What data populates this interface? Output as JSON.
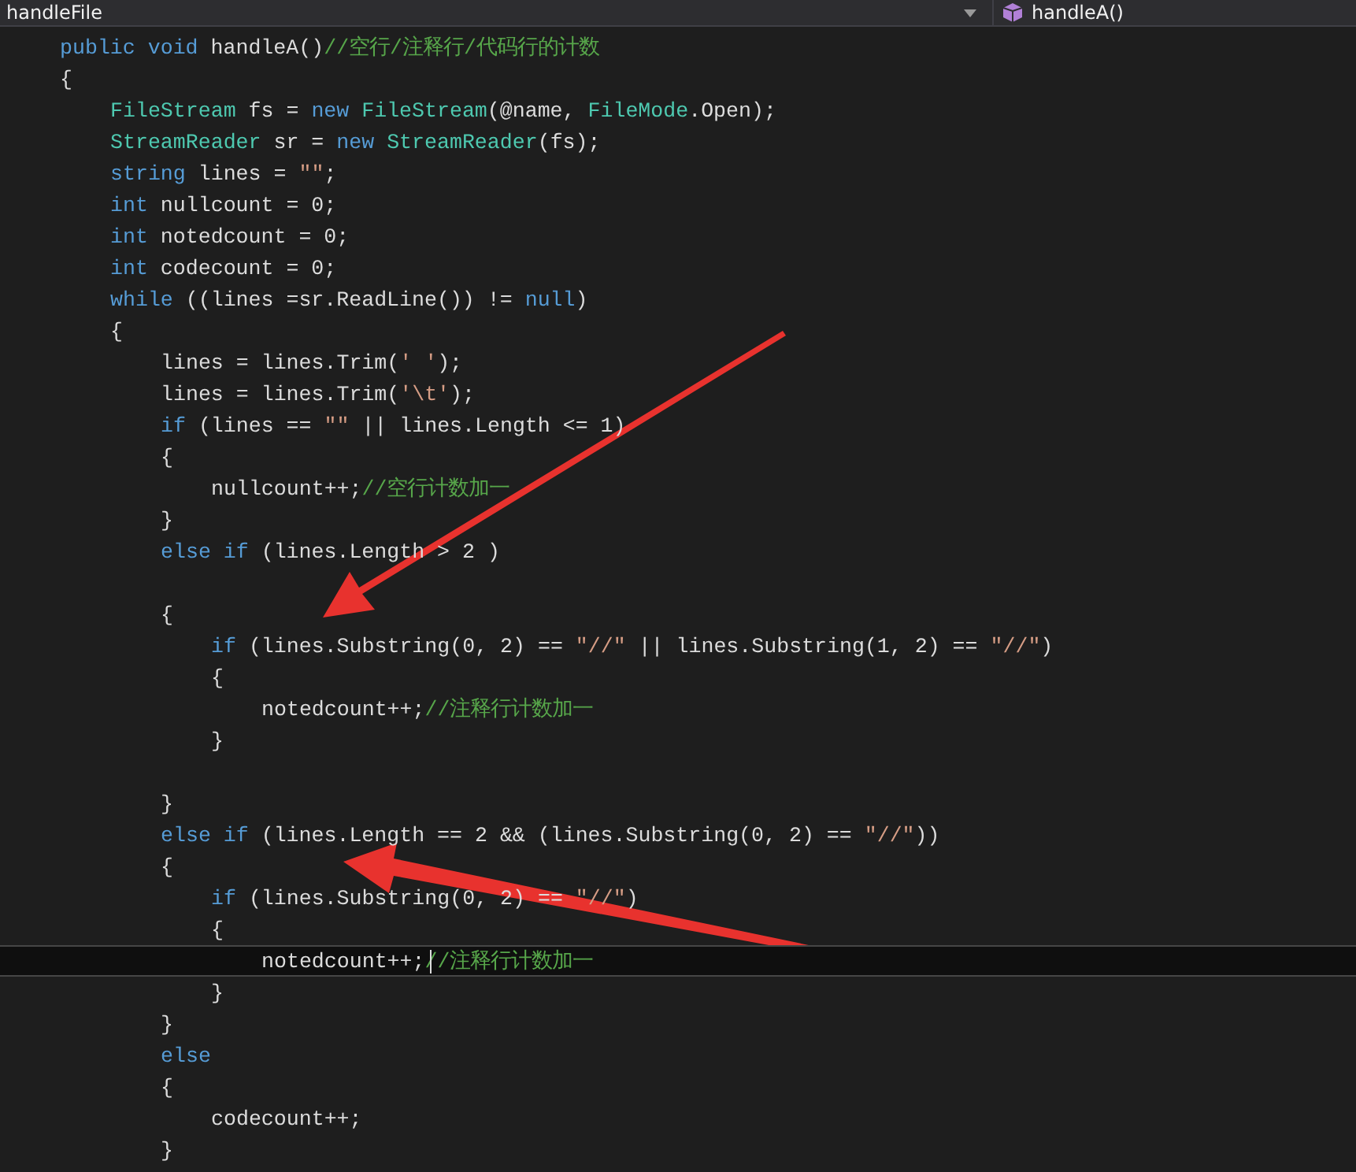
{
  "navigation_bar": {
    "type_dropdown": {
      "value": "handleFile"
    },
    "member_dropdown": {
      "value": "handleA()"
    }
  },
  "editor": {
    "lines": [
      {
        "current": false,
        "tokens": [
          {
            "kind": "keyword",
            "text": "public void "
          },
          {
            "kind": "plain",
            "text": "handleA()"
          },
          {
            "kind": "comment",
            "text": "//空行/注释行/代码行的计数"
          }
        ]
      },
      {
        "current": false,
        "tokens": [
          {
            "kind": "plain",
            "text": "{"
          }
        ],
        "children": [
          {
            "current": false,
            "tokens": [
              {
                "kind": "type",
                "text": "FileStream"
              },
              {
                "kind": "plain",
                "text": " fs = "
              },
              {
                "kind": "keyword",
                "text": "new "
              },
              {
                "kind": "type",
                "text": "FileStream"
              },
              {
                "kind": "plain",
                "text": "(@name, "
              },
              {
                "kind": "type",
                "text": "FileMode"
              },
              {
                "kind": "plain",
                "text": ".Open);"
              }
            ]
          },
          {
            "current": false,
            "tokens": [
              {
                "kind": "type",
                "text": "StreamReader"
              },
              {
                "kind": "plain",
                "text": " sr = "
              },
              {
                "kind": "keyword",
                "text": "new "
              },
              {
                "kind": "type",
                "text": "StreamReader"
              },
              {
                "kind": "plain",
                "text": "(fs);"
              }
            ]
          },
          {
            "current": false,
            "tokens": [
              {
                "kind": "keyword",
                "text": "string"
              },
              {
                "kind": "plain",
                "text": " lines = "
              },
              {
                "kind": "string",
                "text": "\"\""
              },
              {
                "kind": "plain",
                "text": ";"
              }
            ]
          },
          {
            "current": false,
            "tokens": [
              {
                "kind": "keyword",
                "text": "int"
              },
              {
                "kind": "plain",
                "text": " nullcount = 0;"
              }
            ]
          },
          {
            "current": false,
            "tokens": [
              {
                "kind": "keyword",
                "text": "int"
              },
              {
                "kind": "plain",
                "text": " notedcount = 0;"
              }
            ]
          },
          {
            "current": false,
            "tokens": [
              {
                "kind": "keyword",
                "text": "int"
              },
              {
                "kind": "plain",
                "text": " codecount = 0;"
              }
            ]
          },
          {
            "current": false,
            "tokens": [
              {
                "kind": "keyword",
                "text": "while"
              },
              {
                "kind": "plain",
                "text": " ((lines =sr.ReadLine()) != "
              },
              {
                "kind": "keyword",
                "text": "null"
              },
              {
                "kind": "plain",
                "text": ")"
              }
            ]
          },
          {
            "current": false,
            "tokens": [
              {
                "kind": "plain",
                "text": "{"
              }
            ],
            "children": [
              {
                "current": false,
                "tokens": [
                  {
                    "kind": "plain",
                    "text": "lines = lines.Trim("
                  },
                  {
                    "kind": "string",
                    "text": "' '"
                  },
                  {
                    "kind": "plain",
                    "text": ");"
                  }
                ]
              },
              {
                "current": false,
                "tokens": [
                  {
                    "kind": "plain",
                    "text": "lines = lines.Trim("
                  },
                  {
                    "kind": "string",
                    "text": "'\\t'"
                  },
                  {
                    "kind": "plain",
                    "text": ");"
                  }
                ]
              },
              {
                "current": false,
                "tokens": [
                  {
                    "kind": "keyword",
                    "text": "if"
                  },
                  {
                    "kind": "plain",
                    "text": " (lines == "
                  },
                  {
                    "kind": "string",
                    "text": "\"\""
                  },
                  {
                    "kind": "plain",
                    "text": " || lines.Length <= 1)"
                  }
                ]
              },
              {
                "current": false,
                "tokens": [
                  {
                    "kind": "plain",
                    "text": "{"
                  }
                ],
                "children": [
                  {
                    "current": false,
                    "tokens": [
                      {
                        "kind": "plain",
                        "text": "nullcount++;"
                      },
                      {
                        "kind": "comment",
                        "text": "//空行计数加一"
                      }
                    ]
                  }
                ]
              },
              {
                "current": false,
                "tokens": [
                  {
                    "kind": "plain",
                    "text": "}"
                  }
                ]
              },
              {
                "current": false,
                "tokens": [
                  {
                    "kind": "keyword",
                    "text": "else if"
                  },
                  {
                    "kind": "plain",
                    "text": " (lines.Length > 2 )"
                  }
                ]
              },
              {
                "current": false
              },
              {
                "current": false,
                "tokens": [
                  {
                    "kind": "plain",
                    "text": "{"
                  }
                ],
                "children": [
                  {
                    "current": false,
                    "tokens": [
                      {
                        "kind": "keyword",
                        "text": "if"
                      },
                      {
                        "kind": "plain",
                        "text": " (lines.Substring(0, 2) == "
                      },
                      {
                        "kind": "string",
                        "text": "\"//\""
                      },
                      {
                        "kind": "plain",
                        "text": " || lines.Substring(1, 2) == "
                      },
                      {
                        "kind": "string",
                        "text": "\"//\""
                      },
                      {
                        "kind": "plain",
                        "text": ")"
                      }
                    ]
                  },
                  {
                    "current": false,
                    "tokens": [
                      {
                        "kind": "plain",
                        "text": "{"
                      }
                    ],
                    "children": [
                      {
                        "current": false,
                        "tokens": [
                          {
                            "kind": "plain",
                            "text": "notedcount++;"
                          },
                          {
                            "kind": "comment",
                            "text": "//注释行计数加一"
                          }
                        ]
                      }
                    ]
                  },
                  {
                    "current": false,
                    "tokens": [
                      {
                        "kind": "plain",
                        "text": "}"
                      }
                    ]
                  },
                  {
                    "current": false
                  }
                ]
              },
              {
                "current": false,
                "tokens": [
                  {
                    "kind": "plain",
                    "text": "}"
                  }
                ]
              },
              {
                "current": false,
                "tokens": [
                  {
                    "kind": "keyword",
                    "text": "else if"
                  },
                  {
                    "kind": "plain",
                    "text": " (lines.Length == 2 && (lines.Substring(0, 2) == "
                  },
                  {
                    "kind": "string",
                    "text": "\"//\""
                  },
                  {
                    "kind": "plain",
                    "text": "))"
                  }
                ]
              },
              {
                "current": false,
                "tokens": [
                  {
                    "kind": "plain",
                    "text": "{"
                  }
                ],
                "children": [
                  {
                    "current": false,
                    "tokens": [
                      {
                        "kind": "keyword",
                        "text": "if"
                      },
                      {
                        "kind": "plain",
                        "text": " (lines.Substring(0, 2) == "
                      },
                      {
                        "kind": "string",
                        "text": "\"//\""
                      },
                      {
                        "kind": "plain",
                        "text": ")"
                      }
                    ]
                  },
                  {
                    "current": false,
                    "tokens": [
                      {
                        "kind": "plain",
                        "text": "{"
                      }
                    ],
                    "children": [
                      {
                        "current": true,
                        "tokens": [
                          {
                            "kind": "plain",
                            "text": "notedcount++;"
                          },
                          {
                            "kind": "comment",
                            "text": "//注释行计数加一"
                          }
                        ]
                      }
                    ]
                  },
                  {
                    "current": false,
                    "tokens": [
                      {
                        "kind": "plain",
                        "text": "}"
                      }
                    ]
                  }
                ]
              },
              {
                "current": false,
                "tokens": [
                  {
                    "kind": "plain",
                    "text": "}"
                  }
                ]
              },
              {
                "current": false,
                "tokens": [
                  {
                    "kind": "keyword",
                    "text": "else"
                  }
                ]
              },
              {
                "current": false,
                "tokens": [
                  {
                    "kind": "plain",
                    "text": "{"
                  }
                ],
                "children": [
                  {
                    "current": false,
                    "tokens": [
                      {
                        "kind": "plain",
                        "text": "codecount++;"
                      }
                    ]
                  }
                ]
              },
              {
                "current": false,
                "tokens": [
                  {
                    "kind": "plain",
                    "text": "}"
                  }
                ]
              }
            ]
          }
        ]
      }
    ]
  }
}
